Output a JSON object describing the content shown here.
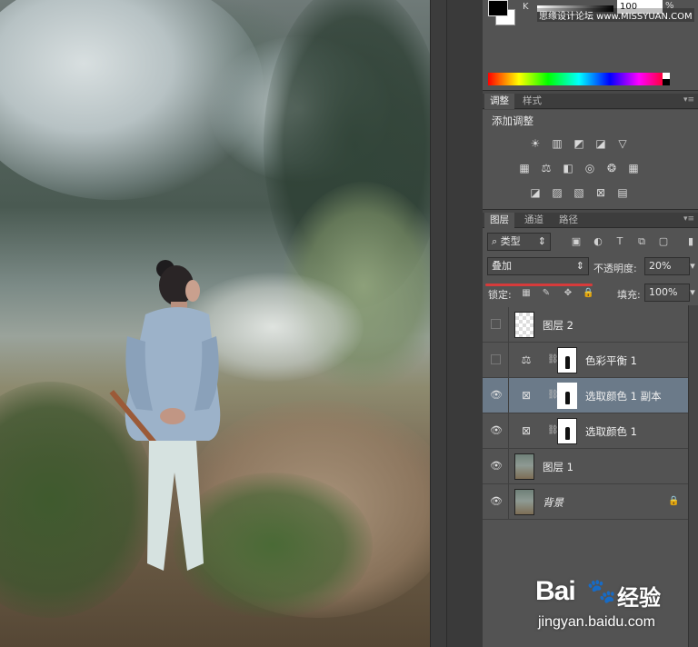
{
  "canvas": {
    "description_icon": "photo-canvas"
  },
  "color_panel": {
    "channel_label": "K",
    "channel_value": "100",
    "channel_unit": "%",
    "watermark": "思缘设计论坛 www.MISSYUAN.COM",
    "fg_color": "#000000",
    "bg_color": "#ffffff"
  },
  "adjust_panel": {
    "tabs": [
      "调整",
      "样式"
    ],
    "title": "添加调整",
    "icons_row1": [
      "brightness-icon",
      "levels-icon",
      "curves-icon",
      "exposure-icon",
      "vibrance-icon"
    ],
    "icons_row2": [
      "hue-saturation-icon",
      "color-balance-icon",
      "black-white-icon",
      "photo-filter-icon",
      "channel-mixer-icon",
      "color-lookup-icon"
    ],
    "icons_row3": [
      "invert-icon",
      "posterize-icon",
      "threshold-icon",
      "selective-color-icon",
      "gradient-map-icon"
    ]
  },
  "layers_panel": {
    "tabs": [
      "图层",
      "通道",
      "路径"
    ],
    "filter_kind": "类型",
    "blend_mode": "叠加",
    "opacity_label": "不透明度:",
    "opacity_value": "20%",
    "lock_label": "锁定:",
    "fill_label": "填充:",
    "fill_value": "100%",
    "layers": [
      {
        "name": "图层 2",
        "visible": false,
        "kind": "pixel"
      },
      {
        "name": "色彩平衡 1",
        "visible": false,
        "kind": "adjustment",
        "adj_icon": "color-balance-icon"
      },
      {
        "name": "选取颜色 1 副本",
        "visible": true,
        "kind": "adjustment",
        "adj_icon": "selective-color-icon",
        "selected": true
      },
      {
        "name": "选取颜色 1",
        "visible": true,
        "kind": "adjustment",
        "adj_icon": "selective-color-icon"
      },
      {
        "name": "图层 1",
        "visible": true,
        "kind": "photo"
      },
      {
        "name": "背景",
        "visible": true,
        "kind": "background",
        "locked": true
      }
    ]
  },
  "watermark": {
    "logo": "Bai",
    "logo_tail": "经验",
    "url": "jingyan.baidu.com"
  }
}
